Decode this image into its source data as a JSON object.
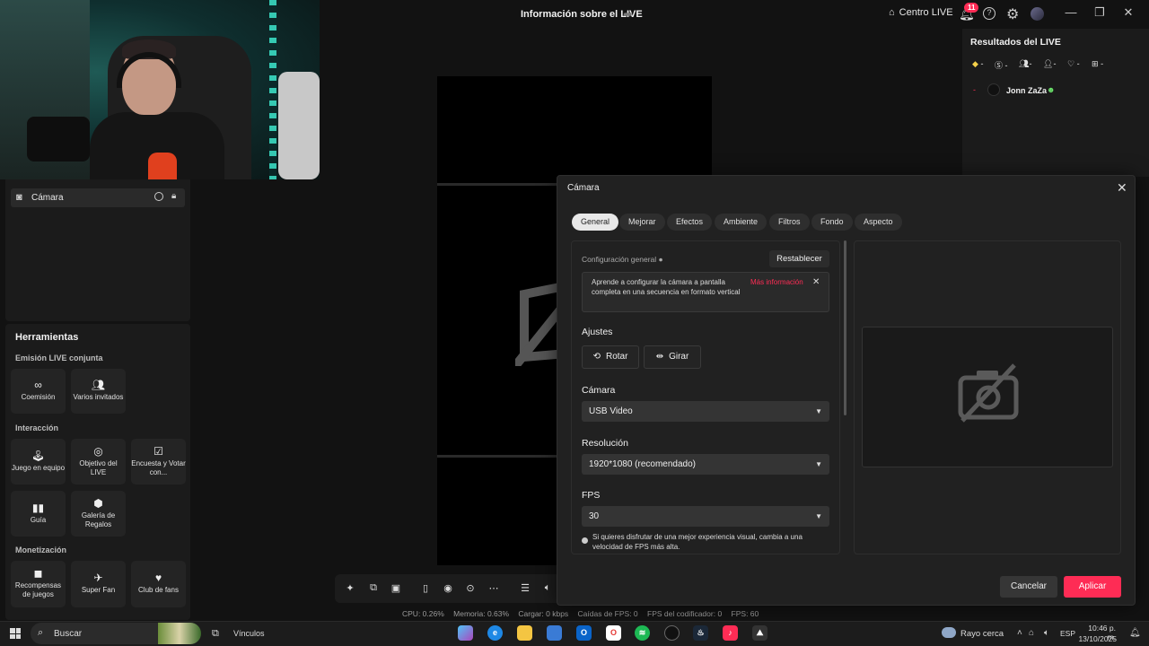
{
  "window": {
    "title": "Información sobre el LIVE",
    "live_center": "Centro LIVE",
    "notification_count": "11"
  },
  "sources": {
    "camera_label": "Cámara"
  },
  "tools": {
    "title": "Herramientas",
    "sections": {
      "joint": "Emisión LIVE conjunta",
      "interaction": "Interacción",
      "monetization": "Monetización"
    },
    "items": {
      "comission": "Coemisión",
      "multi_guests": "Varios invitados",
      "team_game": "Juego en equipo",
      "live_goal": "Objetivo del LIVE",
      "poll": "Encuesta y Votar con...",
      "guide": "Guía",
      "gift_gallery": "Galería de Regalos",
      "game_rewards": "Recompensas de juegos",
      "super_fan": "Super Fan",
      "fan_club": "Club de fans"
    }
  },
  "results": {
    "title": "Resultados del LIVE",
    "stats": [
      "-",
      "-",
      "-",
      "-",
      "-",
      "-"
    ],
    "viewer_rank": "-",
    "viewer_name": "Jonn ZaZa"
  },
  "statusbar": {
    "cpu": "CPU:  0.26%",
    "memory": "Memoria:  0.63%",
    "upload": "Cargar:  0 kbps",
    "fps_drops": "Caídas de FPS:  0",
    "encoder_fps": "FPS del codificador:  0",
    "fps": "FPS:  60"
  },
  "modal": {
    "title": "Cámara",
    "tabs": [
      "General",
      "Mejorar",
      "Efectos",
      "Ambiente",
      "Filtros",
      "Fondo",
      "Aspecto"
    ],
    "active_tab": "General",
    "config_label": "Configuración general",
    "reset": "Restablecer",
    "info_text": "Aprende a configurar la cámara a pantalla completa en una secuencia en formato vertical",
    "info_link": "Más información",
    "adjustments_label": "Ajustes",
    "rotate": "Rotar",
    "flip": "Girar",
    "camera_label": "Cámara",
    "camera_value": "USB Video",
    "resolution_label": "Resolución",
    "resolution_value": "1920*1080 (recomendado)",
    "fps_label": "FPS",
    "fps_value": "30",
    "fps_hint": "Si quieres disfrutar de una mejor experiencia visual, cambia a una velocidad de FPS más alta.",
    "cancel": "Cancelar",
    "apply": "Aplicar"
  },
  "taskbar": {
    "search": "Buscar",
    "links": "Vínculos",
    "weather": "Rayo cerca",
    "lang": "ESP",
    "time": "10:46 p. m.",
    "date": "13/10/2025"
  },
  "colors": {
    "accent": "#fe2c55",
    "background": "#121212",
    "panel": "#1b1b1b"
  }
}
